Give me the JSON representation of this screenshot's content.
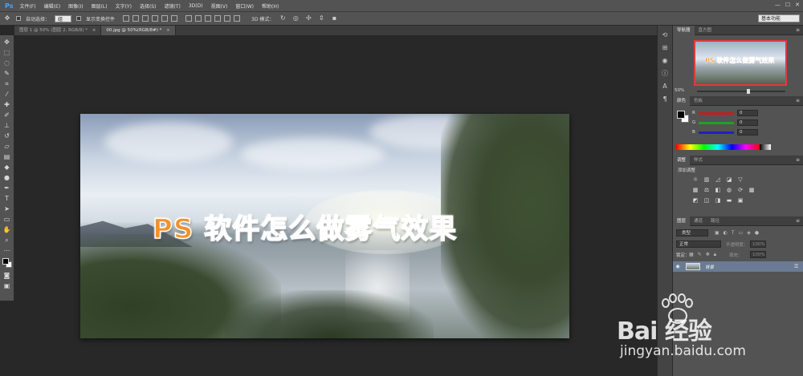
{
  "app": {
    "logo": "Ps"
  },
  "menu": [
    "文件(F)",
    "编辑(E)",
    "图像(I)",
    "图层(L)",
    "文字(Y)",
    "选择(S)",
    "滤镜(T)",
    "3D(D)",
    "视图(V)",
    "窗口(W)",
    "帮助(H)"
  ],
  "window_controls": {
    "minimize": "—",
    "maximize": "☐",
    "close": "✕"
  },
  "options_bar": {
    "auto_select_label": "自动选择：",
    "auto_select_value": "组",
    "show_transform_label": "显示变换控件",
    "mode_3d_label": "3D 模式：",
    "workspace": "基本功能"
  },
  "tabs": [
    {
      "label": "图层 1 @ 50% (图层 2, RGB/8) *",
      "close": "×",
      "active": false
    },
    {
      "label": "00.jpg @ 50%(RGB/8#) *",
      "close": "×",
      "active": true
    }
  ],
  "canvas": {
    "overlay_text": "PS 软件怎么做雾气效果"
  },
  "navigator": {
    "tabs": [
      "导航器",
      "直方图"
    ],
    "thumb_text": "PS 软件怎么做雾气效果",
    "zoom": "50%"
  },
  "color_panel": {
    "tabs": [
      "颜色",
      "色板"
    ],
    "channels": [
      {
        "label": "R",
        "value": "0",
        "color": "#c02020"
      },
      {
        "label": "G",
        "value": "0",
        "color": "#20a020"
      },
      {
        "label": "B",
        "value": "0",
        "color": "#2020c0"
      }
    ]
  },
  "adjustments_panel": {
    "tabs": [
      "调整",
      "样式"
    ],
    "add_label": "添加调整"
  },
  "layers_panel": {
    "tabs": [
      "图层",
      "通道",
      "路径"
    ],
    "filter": "类型",
    "blend_mode": "正常",
    "opacity_label": "不透明度：",
    "opacity_value": "100%",
    "lock_label": "锁定：",
    "fill_label": "填充：",
    "fill_value": "100%",
    "layers": [
      {
        "name": "背景",
        "visible": true,
        "locked": true
      }
    ]
  },
  "watermark": {
    "logo": "Bai 经验",
    "url": "jingyan.baidu.com"
  }
}
